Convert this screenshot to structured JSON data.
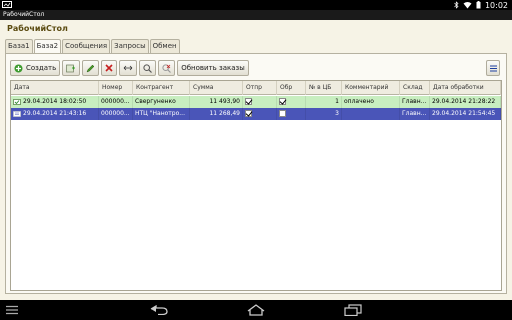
{
  "statusbar": {
    "time": "10:02"
  },
  "window": {
    "title": "РабочийСтол"
  },
  "form": {
    "title": "РабочийСтол"
  },
  "tabs": [
    {
      "label": "База1"
    },
    {
      "label": "База2"
    },
    {
      "label": "Сообщения"
    },
    {
      "label": "Запросы"
    },
    {
      "label": "Обмен"
    }
  ],
  "toolbar": {
    "create_label": "Создать",
    "refresh_orders_label": "Обновить заказы"
  },
  "grid": {
    "columns": [
      "Дата",
      "Номер",
      "Контрагент",
      "Сумма",
      "Отпр",
      "Обр",
      "№ в ЦБ",
      "Комментарий",
      "Склад",
      "Дата обработки"
    ],
    "rows": [
      {
        "date": "29.04.2014 18:02:50",
        "number": "000000...",
        "counterparty": "Свергуненко",
        "sum": "11 493,90",
        "sent": true,
        "processed": true,
        "cb_number": "1",
        "comment": "оплачено",
        "warehouse": "Главн...",
        "processed_date": "29.04.2014 21:28:22"
      },
      {
        "date": "29.04.2014 21:43:16",
        "number": "000000...",
        "counterparty": "НТЦ \"Нанотро...",
        "sum": "11 268,49",
        "sent": true,
        "processed": false,
        "cb_number": "3",
        "comment": "",
        "warehouse": "Главн...",
        "processed_date": "29.04.2014 21:54:45"
      }
    ]
  }
}
